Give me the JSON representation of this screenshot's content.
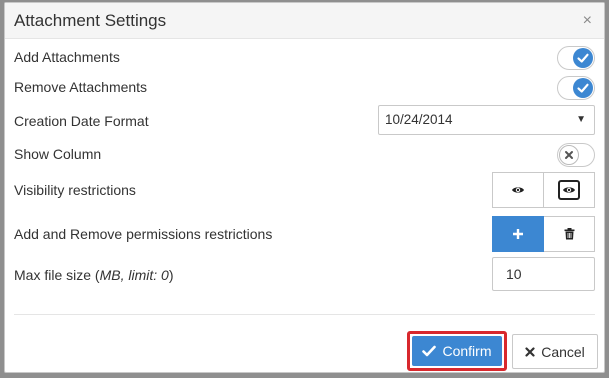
{
  "dialog": {
    "title": "Attachment Settings",
    "close_glyph": "×"
  },
  "settings": {
    "add_attachments": {
      "label": "Add Attachments",
      "enabled": true
    },
    "remove_attachments": {
      "label": "Remove Attachments",
      "enabled": true
    },
    "creation_date_format": {
      "label": "Creation Date Format",
      "value": "10/24/2014"
    },
    "show_column": {
      "label": "Show Column",
      "enabled": false
    },
    "visibility_restrictions": {
      "label": "Visibility restrictions",
      "icons": [
        "eye-icon",
        "eye-box-icon"
      ]
    },
    "permissions_restrictions": {
      "label": "Add and Remove permissions restrictions",
      "icons": [
        "plus-icon",
        "trash-icon"
      ]
    },
    "max_file_size": {
      "label_prefix": "Max file size (",
      "label_italic": "MB, limit: 0",
      "label_suffix": ")",
      "value": "10"
    }
  },
  "footer": {
    "confirm_label": "Confirm",
    "cancel_label": "Cancel"
  },
  "colors": {
    "accent": "#3c87d2",
    "highlight_border": "#d8282d"
  }
}
